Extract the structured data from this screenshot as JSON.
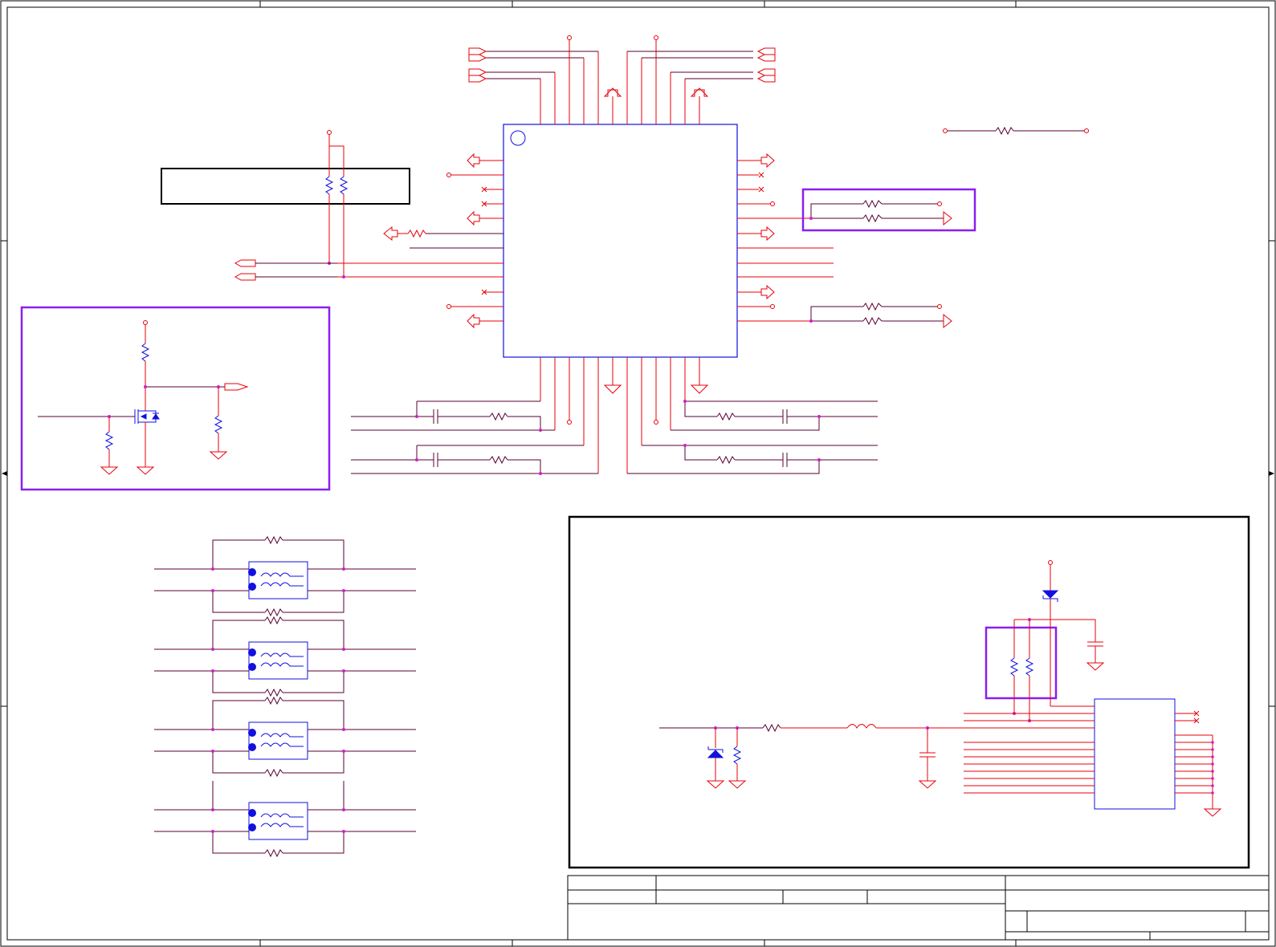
{
  "sheet": {
    "title": "",
    "sheet_number": "",
    "revision": ""
  },
  "colors": {
    "wire": "#e8000a",
    "net": "#5a0030",
    "part": "#1010e0",
    "junction": "#d21dd2",
    "highlight": "#8a1ff0",
    "frame": "#000000"
  },
  "components": {
    "main_ic": {
      "pin1_marker": "circle"
    },
    "mosfet_circuit": {
      "part": "mosfet"
    },
    "usb_connector": {
      "part": "connector"
    },
    "common_mode_chokes": {
      "count": 4
    },
    "tvs_diodes": {
      "count": 2
    }
  },
  "icons": {
    "resistor": "zigzag-resistor-icon",
    "capacitor": "capacitor-icon",
    "ground": "ground-triangle-icon",
    "port": "offpage-port-icon",
    "noconnect": "no-connect-x-icon"
  }
}
